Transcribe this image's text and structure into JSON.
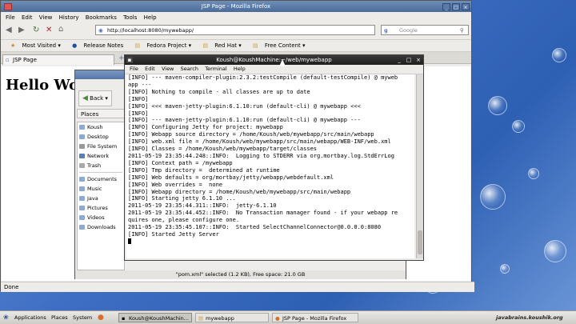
{
  "firefox": {
    "window_title": "JSP Page - Mozilla Firefox",
    "menu": [
      "File",
      "Edit",
      "View",
      "History",
      "Bookmarks",
      "Tools",
      "Help"
    ],
    "url": "http://localhost:8080/mywebapp/",
    "search_placeholder": "Google",
    "bookmarks": [
      "Most Visited",
      "Release Notes",
      "Fedora Project",
      "Red Hat",
      "Free Content"
    ],
    "tab_label": "JSP Page",
    "page_heading": "Hello Wo",
    "status": "Done"
  },
  "nautilus": {
    "back_label": "Back",
    "places_header": "Places",
    "places": [
      "Koush",
      "Desktop",
      "File System",
      "Network",
      "Trash",
      "Documents",
      "Music",
      "Java",
      "Pictures",
      "Videos",
      "Downloads"
    ],
    "status": "\"pom.xml\" selected (1.2 KB), Free space: 21.0 GB"
  },
  "terminal": {
    "window_title": "Koush@KoushMachine:~/web/mywebapp",
    "menu": [
      "File",
      "Edit",
      "View",
      "Search",
      "Terminal",
      "Help"
    ],
    "lines": [
      "[INFO] --- maven-compiler-plugin:2.3.2:testCompile (default-testCompile) @ myweb",
      "app ---",
      "[INFO] Nothing to compile - all classes are up to date",
      "[INFO]",
      "[INFO] <<< maven-jetty-plugin:6.1.10:run (default-cli) @ mywebapp <<<",
      "[INFO]",
      "[INFO] --- maven-jetty-plugin:6.1.10:run (default-cli) @ mywebapp ---",
      "[INFO] Configuring Jetty for project: mywebapp",
      "[INFO] Webapp source directory = /home/Koush/web/mywebapp/src/main/webapp",
      "[INFO] web.xml file = /home/Koush/web/mywebapp/src/main/webapp/WEB-INF/web.xml",
      "[INFO] Classes = /home/Koush/web/mywebapp/target/classes",
      "2011-05-19 23:35:44.248::INFO:  Logging to STDERR via org.mortbay.log.StdErrLog",
      "[INFO] Context path = /mywebapp",
      "[INFO] Tmp directory =  determined at runtime",
      "[INFO] Web defaults = org/mortbay/jetty/webapp/webdefault.xml",
      "[INFO] Web overrides =  none",
      "[INFO] Webapp directory = /home/Koush/web/mywebapp/src/main/webapp",
      "[INFO] Starting jetty 6.1.10 ...",
      "2011-05-19 23:35:44.311::INFO:  jetty-6.1.10",
      "2011-05-19 23:35:44.452::INFO:  No Transaction manager found - if your webapp re",
      "quires one, please configure one.",
      "2011-05-19 23:35:45.107::INFO:  Started SelectChannelConnector@0.0.0.0:8080",
      "[INFO] Started Jetty Server",
      ""
    ]
  },
  "taskbar": {
    "applications": "Applications",
    "places": "Places",
    "system": "System",
    "tasks": [
      "Koush@KoushMachin...",
      "mywebapp",
      "JSP Page - Mozilla Firefox"
    ],
    "brand": "javabrains.koushik.org"
  }
}
